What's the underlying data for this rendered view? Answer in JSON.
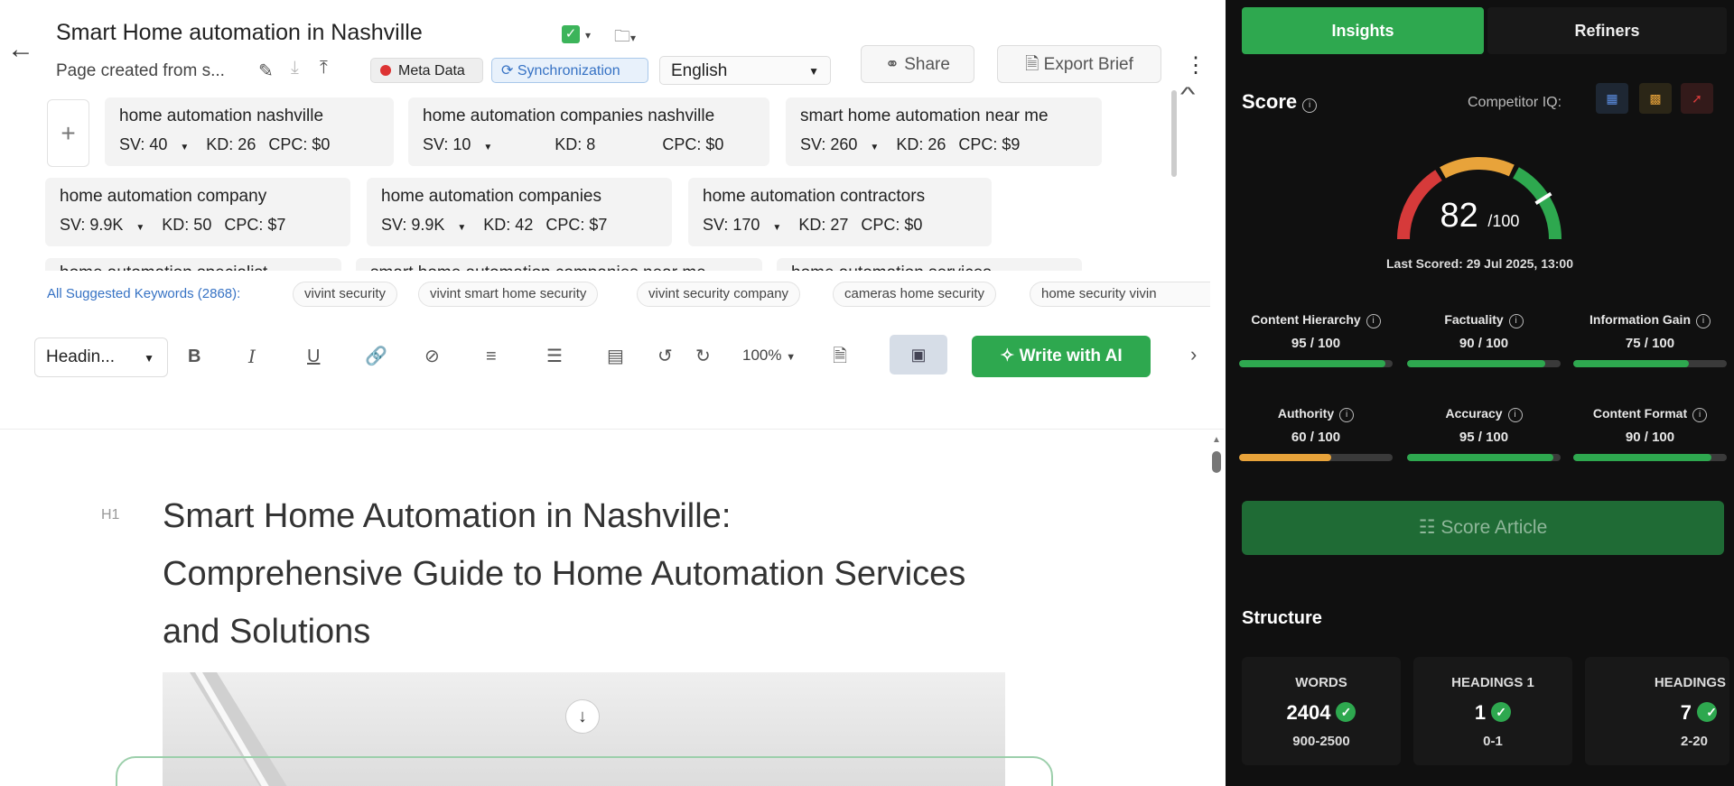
{
  "header": {
    "back_icon": "arrow-left-icon",
    "title": "Smart Home automation in Nashville",
    "subtitle": "Page created from s...",
    "meta_label": "Meta Data",
    "sync_label": "Synchronization",
    "language": "English",
    "share_label": "Share",
    "export_label": "Export Brief"
  },
  "keywords": [
    {
      "name": "home automation nashville",
      "sv": "SV: 40",
      "kd": "KD: 26",
      "cpc": "CPC: $0"
    },
    {
      "name": "home automation companies nashville",
      "sv": "SV: 10",
      "kd": "KD: 8",
      "cpc": "CPC: $0"
    },
    {
      "name": "smart home automation near me",
      "sv": "SV: 260",
      "kd": "KD: 26",
      "cpc": "CPC: $9"
    },
    {
      "name": "home automation company",
      "sv": "SV: 9.9K",
      "kd": "KD: 50",
      "cpc": "CPC: $7"
    },
    {
      "name": "home automation companies",
      "sv": "SV: 9.9K",
      "kd": "KD: 42",
      "cpc": "CPC: $7"
    },
    {
      "name": "home automation contractors",
      "sv": "SV: 170",
      "kd": "KD: 27",
      "cpc": "CPC: $0"
    },
    {
      "name": "home automation specialist",
      "sv": "",
      "kd": "",
      "cpc": ""
    },
    {
      "name": "smart home automation companies near me",
      "sv": "",
      "kd": "",
      "cpc": ""
    },
    {
      "name": "home automation services",
      "sv": "",
      "kd": "",
      "cpc": ""
    }
  ],
  "suggested": {
    "label": "All Suggested Keywords (2868):",
    "chips": [
      "vivint security",
      "vivint smart home security",
      "vivint security company",
      "cameras home security",
      "home security vivin"
    ]
  },
  "toolbar": {
    "heading_select": "Headin...",
    "zoom": "100%",
    "write_ai": "Write with AI"
  },
  "editor": {
    "h1_tag": "H1",
    "h1_text": "Smart Home Automation in Nashville: Comprehensive Guide to Home Automation Services and Solutions"
  },
  "panel": {
    "tabs": [
      "Insights",
      "Refiners"
    ],
    "score_label": "Score",
    "competitor_label": "Competitor IQ:",
    "score_value": "82",
    "score_max": "/100",
    "last_scored": "Last Scored: 29 Jul 2025, 13:00",
    "metrics": [
      {
        "name": "Content Hierarchy",
        "value": "95 / 100",
        "pct": 95,
        "color": "#2ea84f"
      },
      {
        "name": "Factuality",
        "value": "90 / 100",
        "pct": 90,
        "color": "#2ea84f"
      },
      {
        "name": "Information Gain",
        "value": "75 / 100",
        "pct": 75,
        "color": "#2ea84f"
      },
      {
        "name": "Authority",
        "value": "60 / 100",
        "pct": 60,
        "color": "#e8a33a"
      },
      {
        "name": "Accuracy",
        "value": "95 / 100",
        "pct": 95,
        "color": "#2ea84f"
      },
      {
        "name": "Content Format",
        "value": "90 / 100",
        "pct": 90,
        "color": "#2ea84f"
      }
    ],
    "score_article": "Score Article",
    "structure_label": "Structure",
    "stats": [
      {
        "name": "WORDS",
        "value": "2404",
        "range": "900-2500"
      },
      {
        "name": "HEADINGS 1",
        "value": "1",
        "range": "0-1"
      },
      {
        "name": "HEADINGS",
        "value": "7",
        "range": "2-20"
      }
    ],
    "colors": {
      "accent": "#2ea84f",
      "warn": "#e8a33a",
      "bad": "#d63a3a",
      "bg": "#101010"
    }
  }
}
